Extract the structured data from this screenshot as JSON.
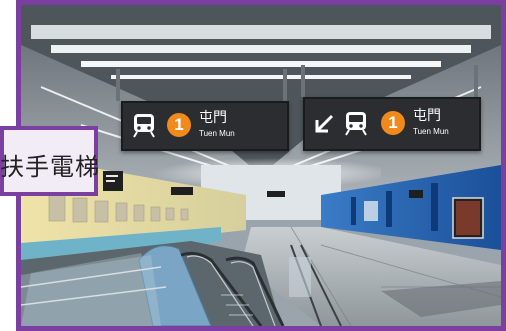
{
  "sign_left": {
    "line_number": "1",
    "station_cn": "屯門",
    "station_en": "Tuen Mun"
  },
  "sign_right": {
    "direction_arrow": "arrow-down-left-icon",
    "line_number": "1",
    "station_cn": "屯門",
    "station_en": "Tuen Mun"
  },
  "callout": {
    "text": "扶手電梯"
  },
  "colors": {
    "frame_accent": "#7a3fa0",
    "line_badge": "#f08a1b",
    "sign_background": "#2b2d31",
    "wall_blue": "#1f5fb0",
    "wall_yellow": "#e8d89a"
  }
}
